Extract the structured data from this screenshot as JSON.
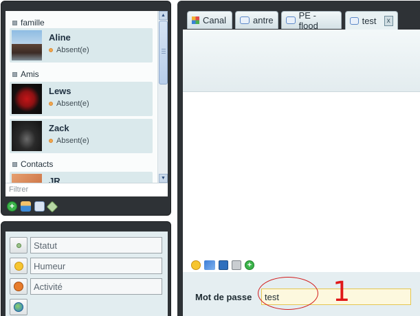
{
  "contacts_panel": {
    "groups": [
      {
        "name": "famille"
      },
      {
        "name": "Amis"
      },
      {
        "name": "Contacts"
      }
    ],
    "contacts": [
      {
        "name": "Aline",
        "status": "Absent(e)"
      },
      {
        "name": "Lews",
        "status": "Absent(e)"
      },
      {
        "name": "Zack",
        "status": "Absent(e)"
      },
      {
        "name": "JR",
        "status": ""
      }
    ],
    "filter_placeholder": "Filtrer",
    "toolbar": [
      "add-contact-icon",
      "users-icon",
      "chat-bubbles-icon",
      "tag-icon"
    ]
  },
  "status_panel": {
    "statut_placeholder": "Statut",
    "humeur_placeholder": "Humeur",
    "activite_placeholder": "Activité"
  },
  "tabs": [
    {
      "label": "Canal",
      "icon": "grid-icon"
    },
    {
      "label": "antre",
      "icon": "chat-bubbles-icon"
    },
    {
      "label": "PE - flood",
      "icon": "chat-bubbles-icon"
    },
    {
      "label": "test",
      "icon": "chat-bubbles-icon",
      "active": true,
      "close": "x"
    }
  ],
  "chat": {
    "tools": [
      "smiley-icon",
      "translate-icon",
      "save-icon",
      "lock-icon",
      "add-icon"
    ],
    "password_label": "Mot de passe",
    "password_value": "test"
  },
  "annotation": {
    "number": "1",
    "color": "#e01818"
  },
  "colors": {
    "frame": "#2e3236",
    "contact_bg": "#dae9ec",
    "away": "#f0a64d",
    "input_highlight": "#fdf8de"
  }
}
